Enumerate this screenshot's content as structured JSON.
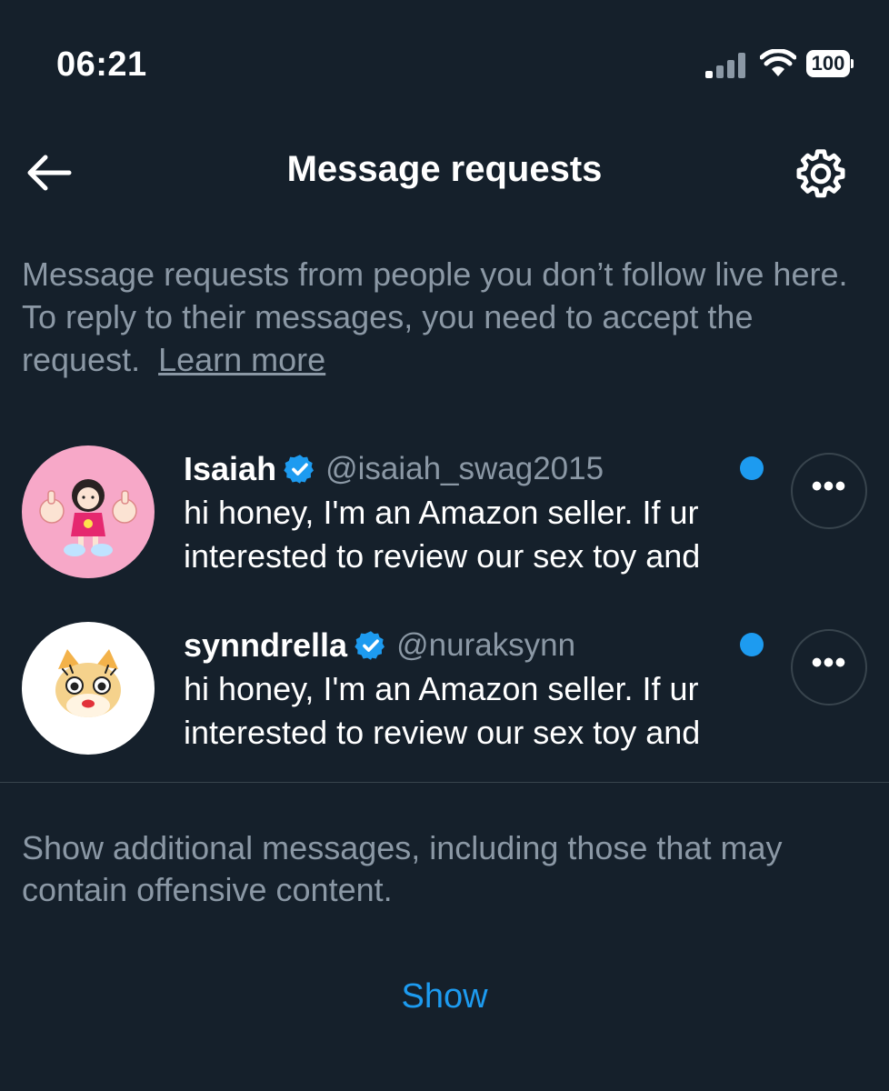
{
  "status_bar": {
    "time": "06:21",
    "battery": "100",
    "signal_bars_active": 1,
    "signal_bars_total": 4
  },
  "header": {
    "title": "Message requests",
    "back_icon": "arrow-left-icon",
    "settings_icon": "gear-icon"
  },
  "info": {
    "text": "Message requests from people you don’t follow live here. To reply to their messages, you need to accept the request.",
    "learn_more": "Learn more"
  },
  "requests": [
    {
      "name": "Isaiah",
      "handle": "@isaiah_swag2015",
      "preview_line1": "hi honey, I'm an Amazon seller. If ur",
      "preview_line2": "interested to review our sex toy and",
      "verified": true,
      "unread": true,
      "avatar_bg": "#f7a8c8"
    },
    {
      "name": "synndrella",
      "handle": "@nuraksynn",
      "preview_line1": "hi honey, I'm an Amazon seller. If ur",
      "preview_line2": "interested to review our sex toy and",
      "verified": true,
      "unread": true,
      "avatar_bg": "#ffffff"
    }
  ],
  "more_label": "•••",
  "additional": {
    "text": "Show additional messages, including those that may contain offensive content.",
    "show_label": "Show"
  },
  "colors": {
    "background": "#15202b",
    "accent": "#1d9bf0",
    "secondary_text": "#8b98a5",
    "border": "#38444d"
  }
}
